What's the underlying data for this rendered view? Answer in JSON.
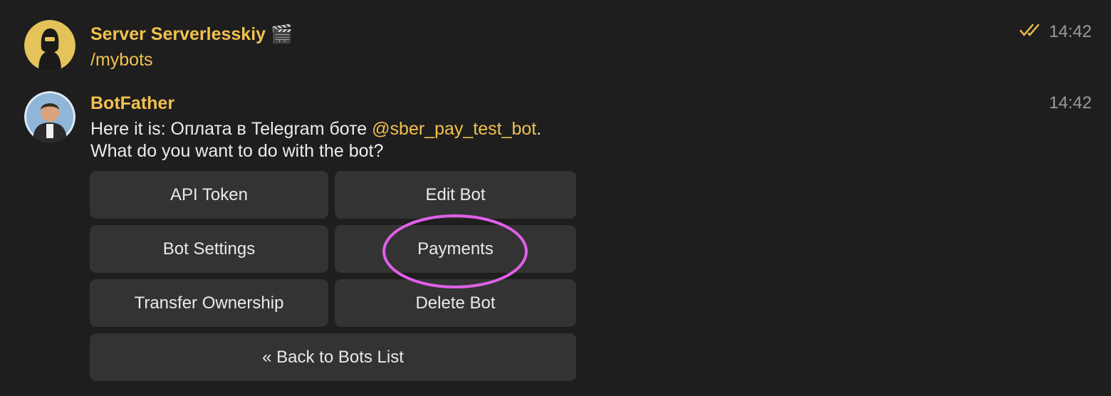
{
  "messages": [
    {
      "sender": "Server Serverlesskiy",
      "sender_emoji": "🎬",
      "text": "/mybots",
      "time": "14:42",
      "read_status": "double-check-icon"
    },
    {
      "sender": "BotFather",
      "text_prefix": "Here it is: Оплата в Telegram боте ",
      "mention": "@sber_pay_test_bot",
      "text_suffix": ".",
      "text_line2": "What do you want to do with the bot?",
      "time": "14:42"
    }
  ],
  "keyboard": {
    "api_token": "API Token",
    "edit_bot": "Edit Bot",
    "bot_settings": "Bot Settings",
    "payments": "Payments",
    "transfer_ownership": "Transfer Ownership",
    "delete_bot": "Delete Bot",
    "back": "« Back to Bots List"
  },
  "colors": {
    "background": "#1e1e1e",
    "accent": "#f2c14e",
    "button": "#333333",
    "highlight_ring": "#e060e8"
  }
}
